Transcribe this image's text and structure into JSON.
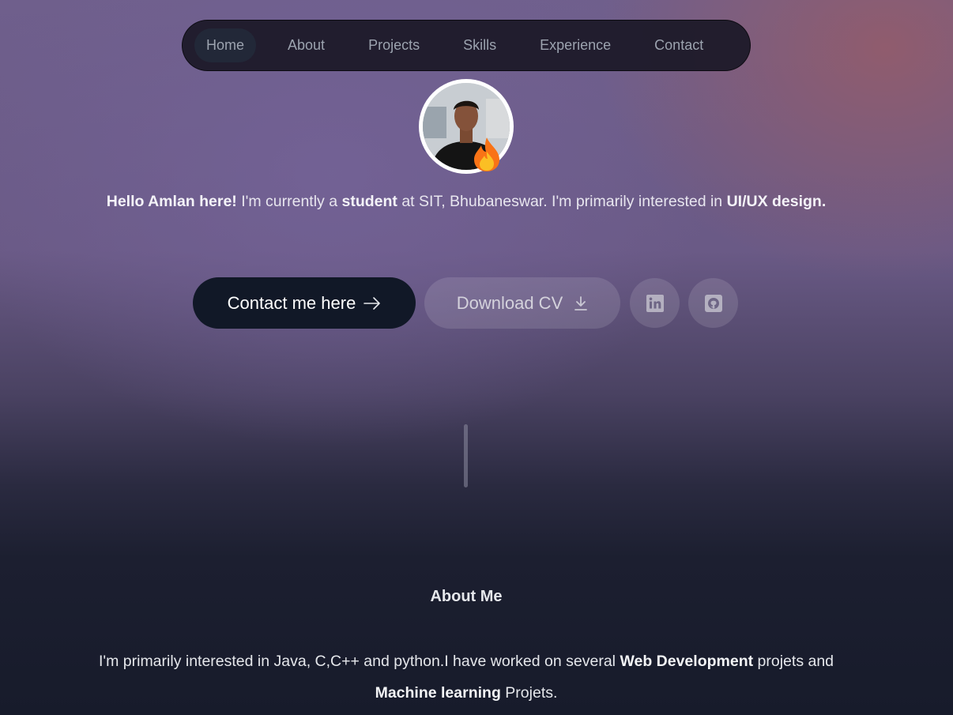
{
  "nav": {
    "items": [
      {
        "label": "Home",
        "active": true
      },
      {
        "label": "About"
      },
      {
        "label": "Projects"
      },
      {
        "label": "Skills"
      },
      {
        "label": "Experience"
      },
      {
        "label": "Contact"
      }
    ]
  },
  "intro": {
    "greeting": "Hello Amlan here!",
    "part1": " I'm currently a ",
    "role": "student",
    "part2": " at SIT, Bhubaneswar. I'm primarily interested in ",
    "interest": "UI/UX design."
  },
  "actions": {
    "contact_label": "Contact me here",
    "cv_label": "Download CV",
    "linkedin_icon": "linkedin-icon",
    "github_icon": "github-icon"
  },
  "about": {
    "heading": "About Me",
    "part1": "I'm primarily interested in Java, C,C++ and python.I have worked on several ",
    "highlight1": "Web Development",
    "part2": " projets and ",
    "highlight2": "Machine learning",
    "part3": " Projets."
  },
  "colors": {
    "contact_button_bg": "#111827",
    "nav_bg": "#1a1826",
    "nav_active_bg": "#222838"
  }
}
